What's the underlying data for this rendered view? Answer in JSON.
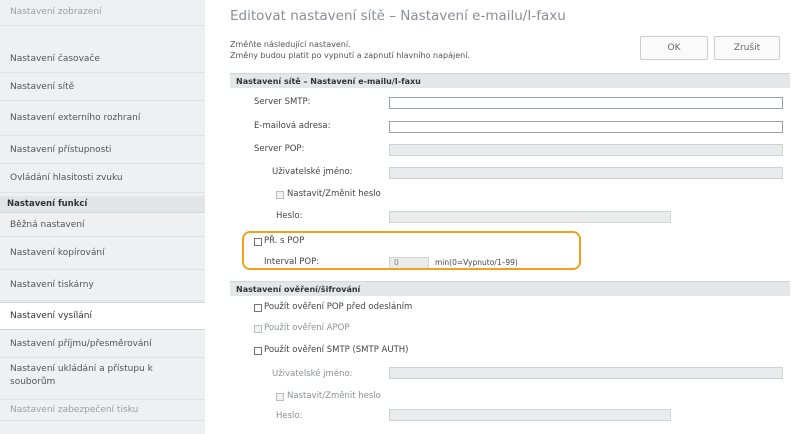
{
  "sidebar": {
    "items": [
      {
        "label": "Nastavení zobrazení"
      },
      {
        "label": "Nastavení časovače"
      },
      {
        "label": "Nastavení sítě"
      },
      {
        "label": "Nastavení externího rozhraní"
      },
      {
        "label": "Nastavení přístupnosti"
      },
      {
        "label": "Ovládání hlasitosti zvuku"
      }
    ],
    "section_header": "Nastavení funkcí",
    "function_items": [
      {
        "label": "Běžná nastavení"
      },
      {
        "label": "Nastavení kopírování"
      },
      {
        "label": "Nastavení tiskárny"
      },
      {
        "label": "Nastavení vysílání"
      },
      {
        "label": "Nastavení příjmu/přesměrování"
      },
      {
        "label_line1": "Nastavení ukládání a přístupu k",
        "label_line2": "souborům"
      },
      {
        "label": "Nastavení zabezpečení tisku"
      }
    ]
  },
  "main": {
    "title": "Editovat nastavení sítě – Nastavení e-mailu/I-faxu",
    "note_line1": "Změňte následující nastavení.",
    "note_line2": "Změny budou platit po vypnutí a zapnutí hlavního napájení.",
    "ok_label": "OK",
    "cancel_label": "Zrušit",
    "section1_title": "Nastavení sítě – Nastavení e-mailu/I-faxu",
    "smtp_server_label": "Server SMTP:",
    "email_address_label": "E-mailová adresa:",
    "pop_server_label": "Server POP:",
    "username_label": "Uživatelské jméno:",
    "set_change_password_label": "Nastavit/Změnit heslo",
    "password_label": "Heslo:",
    "rx_pop_label": "PŘ. s POP",
    "pop_interval_label": "Interval POP:",
    "pop_interval_value": "0",
    "pop_interval_unit": "min(0=Vypnuto/1–99)",
    "section2_title": "Nastavení ověření/šifrování",
    "use_pop_auth_label": "Použít ověření POP před odesláním",
    "use_apop_label": "Použít ověření APOP",
    "use_smtp_auth_label": "Použít ověření SMTP (SMTP AUTH)",
    "smtp_username_label": "Uživatelské jméno:",
    "smtp_set_change_password_label": "Nastavit/Změnit heslo",
    "smtp_password_label": "Heslo:"
  },
  "colors": {
    "highlight": "#f0a21f",
    "sidebar_bg": "#eef0f2",
    "section_bar_bg": "#e4e6e8"
  }
}
